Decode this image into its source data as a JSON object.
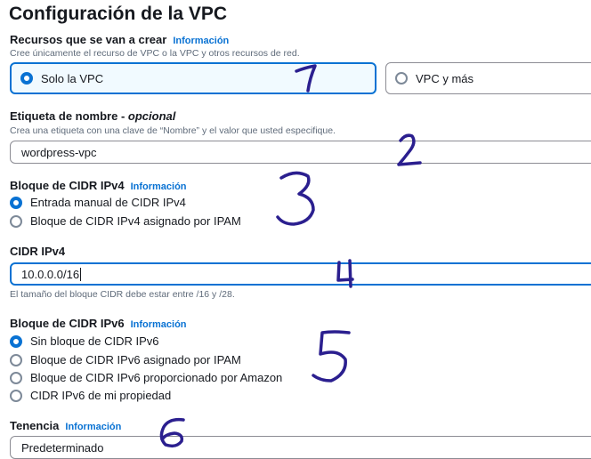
{
  "page": {
    "title": "Configuración de la VPC"
  },
  "resources": {
    "label": "Recursos que se van a crear",
    "info": "Información",
    "description": "Cree únicamente el recurso de VPC o la VPC y otros recursos de red.",
    "options": [
      {
        "label": "Solo la VPC",
        "selected": true
      },
      {
        "label": "VPC y más",
        "selected": false
      }
    ]
  },
  "name_tag": {
    "label": "Etiqueta de nombre - ",
    "optional": "opcional",
    "description": "Crea una etiqueta con una clave de “Nombre” y el valor que usted especifique.",
    "value": "wordpress-vpc"
  },
  "ipv4_block": {
    "label": "Bloque de CIDR IPv4",
    "info": "Información",
    "options": [
      {
        "label": "Entrada manual de CIDR IPv4",
        "selected": true
      },
      {
        "label": "Bloque de CIDR IPv4 asignado por IPAM",
        "selected": false
      }
    ]
  },
  "ipv4_cidr": {
    "label": "CIDR IPv4",
    "value": "10.0.0.0/16",
    "hint": "El tamaño del bloque CIDR debe estar entre /16 y /28."
  },
  "ipv6_block": {
    "label": "Bloque de CIDR IPv6",
    "info": "Información",
    "options": [
      {
        "label": "Sin bloque de CIDR IPv6",
        "selected": true
      },
      {
        "label": "Bloque de CIDR IPv6 asignado por IPAM",
        "selected": false
      },
      {
        "label": "Bloque de CIDR IPv6 proporcionado por Amazon",
        "selected": false
      },
      {
        "label": "CIDR IPv6 de mi propiedad",
        "selected": false
      }
    ]
  },
  "tenancy": {
    "label": "Tenencia",
    "info": "Información",
    "value": "Predeterminado"
  },
  "annotations": [
    "1",
    "2",
    "3",
    "4",
    "5",
    "6"
  ],
  "colors": {
    "accent": "#0972d3",
    "annotation_ink": "#2b1f8f",
    "text": "#16191f",
    "muted": "#5f6b7a"
  }
}
